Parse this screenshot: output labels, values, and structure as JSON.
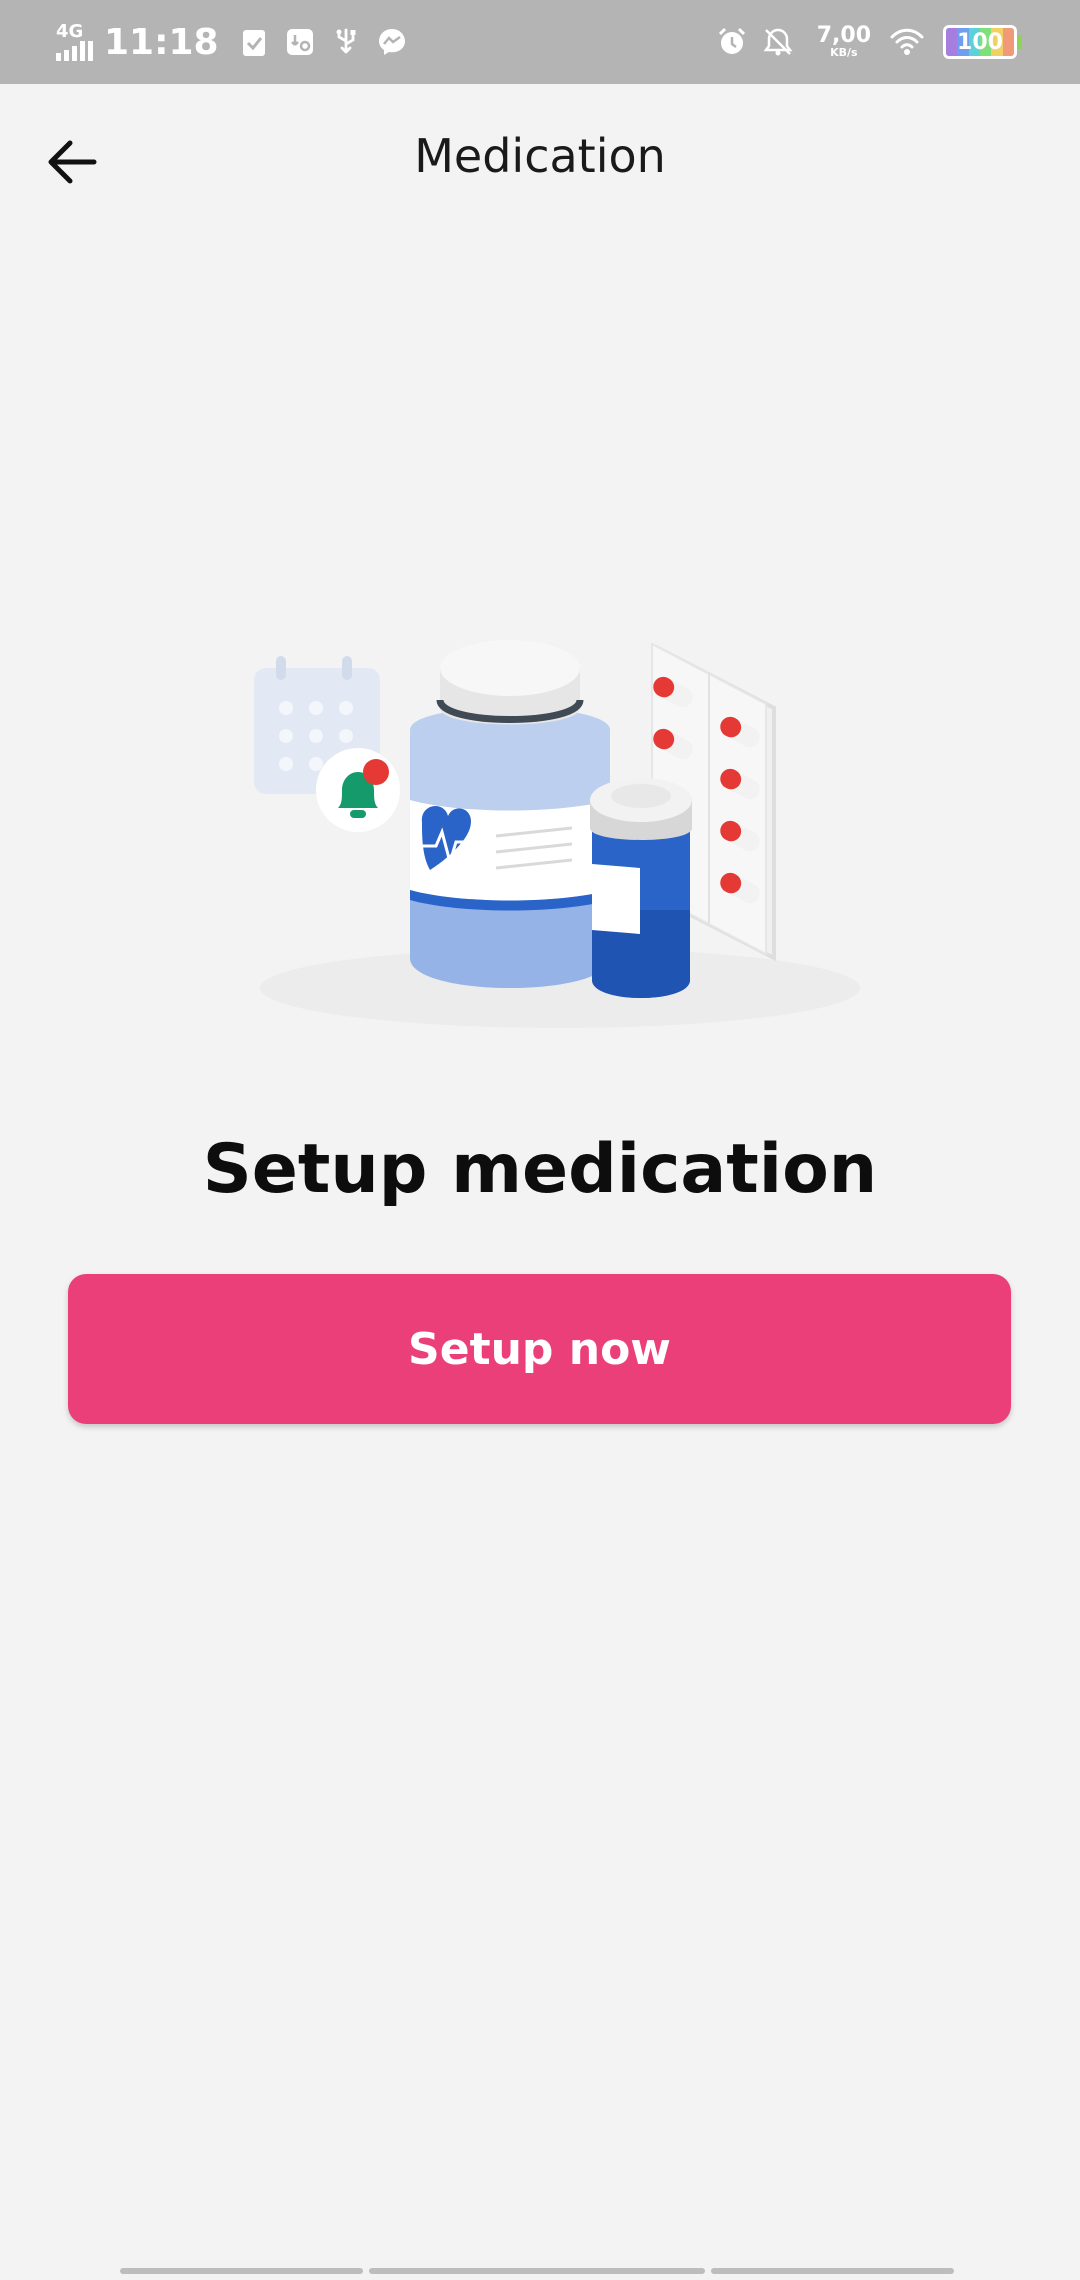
{
  "status_bar": {
    "network": "4G",
    "time": "11:18",
    "speed_value": "7,00",
    "speed_unit": "KB/s",
    "battery_level": "100",
    "icons": [
      "signal-icon",
      "clipboard-check-icon",
      "usb-settings-icon",
      "usb-icon",
      "messenger-icon",
      "alarm-icon",
      "notifications-off-icon",
      "wifi-icon",
      "battery-icon"
    ]
  },
  "header": {
    "title": "Medication",
    "back_icon": "arrow-left-icon"
  },
  "main": {
    "heading": "Setup medication",
    "button_label": "Setup now",
    "illustration_icon": "medication-illustration"
  },
  "colors": {
    "accent": "#ea3f78",
    "background": "#f3f3f3",
    "status_bar": "#b4b4b4",
    "pill_red": "#e53935",
    "bottle_blue": "#2a64c9",
    "bottle_light": "#bccfee",
    "bell_green": "#159a6c"
  }
}
